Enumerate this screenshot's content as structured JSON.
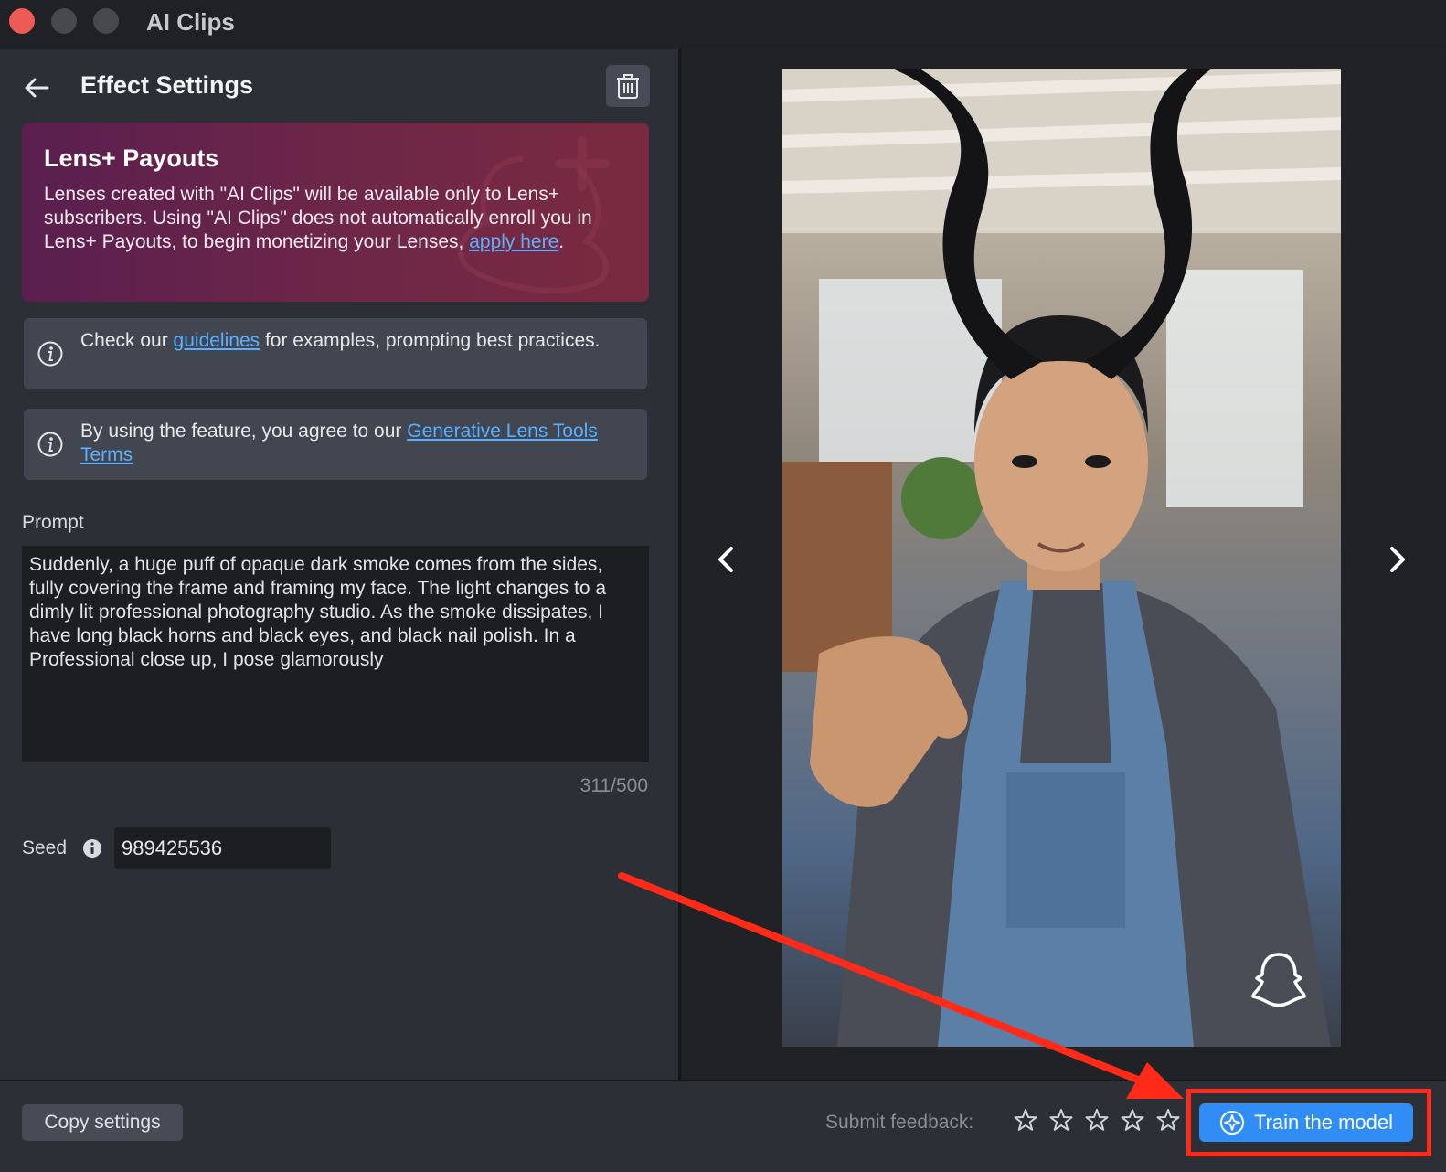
{
  "window": {
    "title": "AI Clips"
  },
  "header": {
    "title": "Effect Settings"
  },
  "promo": {
    "title": "Lens+ Payouts",
    "text_before_link": "Lenses created with \"AI Clips\" will be available only to Lens+ subscribers. Using \"AI Clips\" does not automatically enroll you in Lens+ Payouts, to begin monetizing your Lenses, ",
    "link": "apply here",
    "text_after_link": "."
  },
  "info_guidelines": {
    "before": "Check our ",
    "link": "guidelines",
    "after": " for examples, prompting best practices."
  },
  "info_terms": {
    "before": "By using the feature, you agree to our ",
    "link": "Generative Lens Tools Terms",
    "after": ""
  },
  "prompt": {
    "label": "Prompt",
    "value": "Suddenly, a huge puff of opaque dark smoke comes from the sides, fully covering the frame and framing my face. The light changes to a dimly lit professional photography studio. As the smoke dissipates, I have long black horns and black eyes, and black nail polish. In a Professional close up, I pose glamorously",
    "counter": "311/500"
  },
  "seed": {
    "label": "Seed",
    "value": "989425536"
  },
  "footer": {
    "copy_label": "Copy settings",
    "feedback_label": "Submit feedback:",
    "star_count": 5,
    "train_label": "Train the model"
  },
  "colors": {
    "accent": "#2f8df5",
    "link": "#5ab0ff",
    "annotation": "#ff2a17",
    "promo_gradient_start": "#5a1f4f",
    "promo_gradient_end": "#7a2a3f"
  },
  "icons": [
    "back-arrow-icon",
    "trash-icon",
    "info-icon",
    "chevron-left-icon",
    "chevron-right-icon",
    "star-outline-icon",
    "train-sparkle-icon",
    "snapchat-ghost-icon"
  ]
}
